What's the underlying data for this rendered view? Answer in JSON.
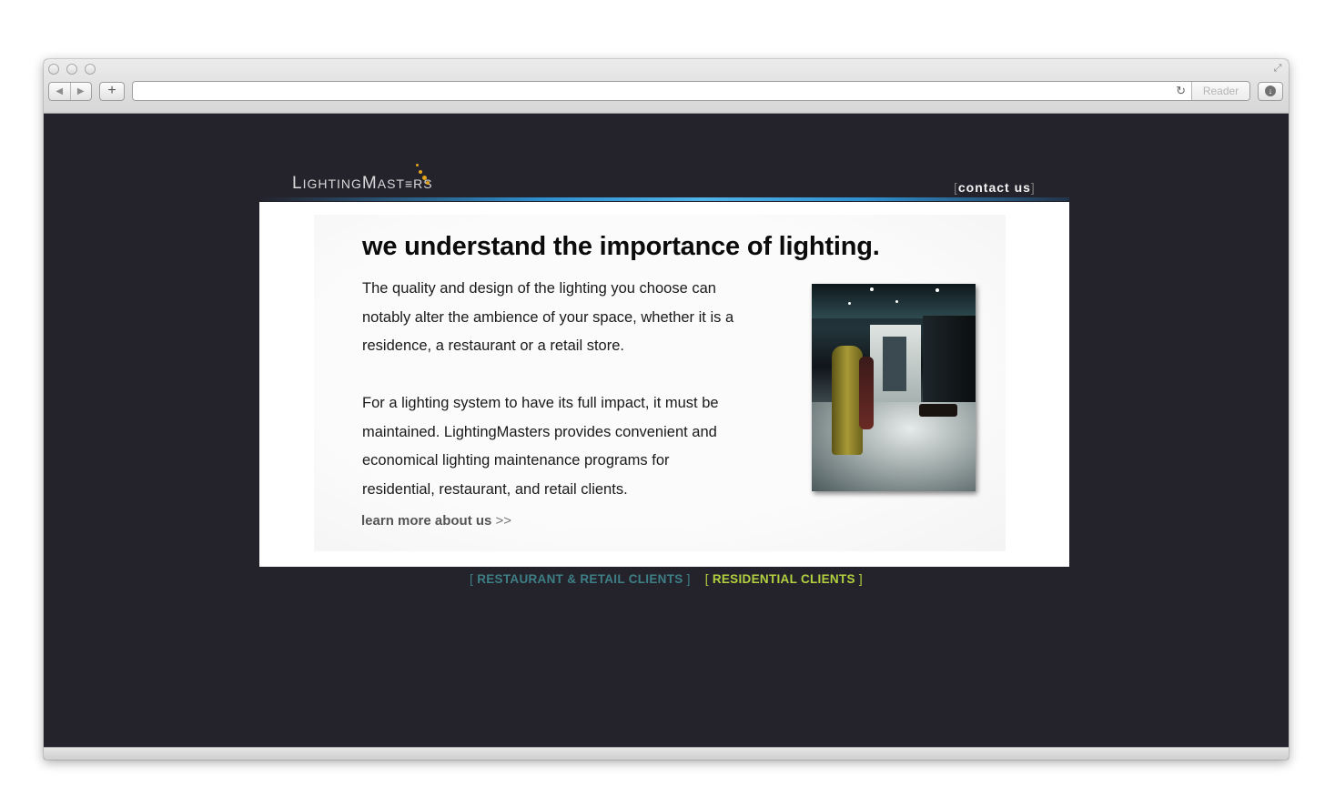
{
  "browser": {
    "reader_label": "Reader",
    "url": ""
  },
  "site": {
    "logo": {
      "part1": "L",
      "part2": "IGHTING",
      "part3": "M",
      "part4": "AST",
      "part5": "RS"
    },
    "contact": {
      "open": "[",
      "label": "contact us",
      "close": "]"
    },
    "headline": "we understand the importance of lighting.",
    "paragraph1": "The quality and design of the lighting you choose can notably alter the ambience of your space, whether it is a residence, a restaurant or a retail store.",
    "paragraph2": "For a lighting system to have its full impact, it must be maintained.  LightingMasters provides convenient and economical lighting maintenance programs for residential,  restaurant, and retail clients.",
    "learn_more": {
      "label": "learn more about us",
      "arrows": ">>"
    },
    "clients": {
      "restaurant_retail": {
        "open": "[",
        "label": " RESTAURANT & RETAIL CLIENTS ",
        "close": "]"
      },
      "residential": {
        "open": "[",
        "label": " RESIDENTIAL CLIENTS ",
        "close": "]"
      }
    }
  },
  "colors": {
    "page_background": "#24232c",
    "accent_blue": "#4fb4ea",
    "restaurant_link": "#3e7f86",
    "residential_link": "#b3d13f",
    "logo_dots": "#e0a21c"
  }
}
